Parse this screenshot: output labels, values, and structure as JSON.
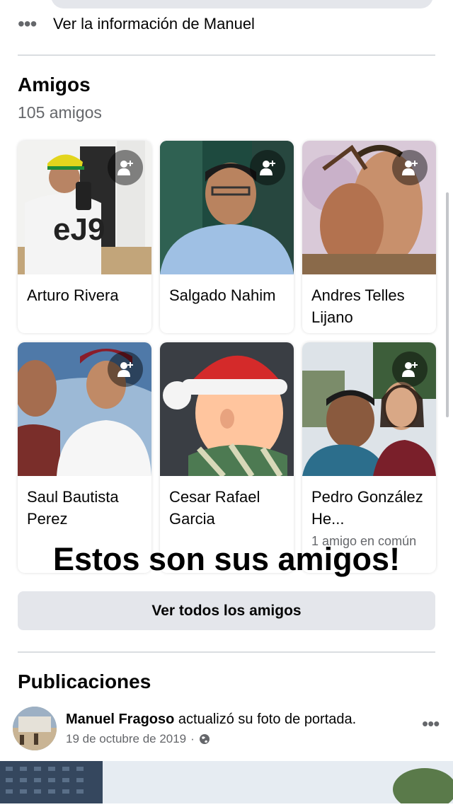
{
  "info_row": {
    "more_icon": "more-dots-icon",
    "text": "Ver la información de Manuel"
  },
  "friends": {
    "title": "Amigos",
    "count": "105 amigos",
    "cards": [
      {
        "name": "Arturo Rivera",
        "mutual": ""
      },
      {
        "name": "Salgado Nahim",
        "mutual": ""
      },
      {
        "name": "Andres Telles Lijano",
        "mutual": ""
      },
      {
        "name": "Saul Bautista Perez",
        "mutual": ""
      },
      {
        "name": "Cesar Rafael Garcia",
        "mutual": ""
      },
      {
        "name": "Pedro González He...",
        "mutual": "1 amigo en común"
      }
    ],
    "add_icon": "add-friend-icon",
    "see_all": "Ver todos los amigos"
  },
  "overlay_text": "Estos son sus amigos!",
  "posts": {
    "title": "Publicaciones",
    "author": "Manuel Fragoso",
    "action": "actualizó su foto de portada.",
    "date": "19 de octubre de 2019",
    "privacy_icon": "globe-icon",
    "more_icon": "more-dots-icon"
  },
  "colors": {
    "secondary_text": "#65676b",
    "button_bg": "#e4e6eb",
    "divider": "#dadde1"
  }
}
